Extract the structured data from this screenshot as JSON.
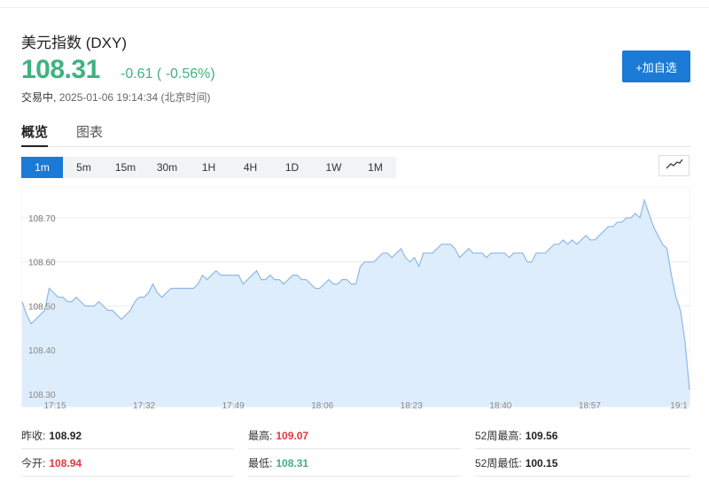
{
  "header": {
    "title": "美元指数 (DXY)",
    "price": "108.31",
    "change": "-0.61 ( -0.56%)",
    "status_label": "交易中,",
    "timestamp": "2025-01-06 19:14:34 (北京时间)",
    "add_button": "+加自选",
    "color_down": "#3fb27f",
    "color_up": "#e0393e",
    "accent": "#1a7ad6"
  },
  "tabs": [
    {
      "label": "概览",
      "active": true
    },
    {
      "label": "图表",
      "active": false
    }
  ],
  "intervals": [
    {
      "label": "1m",
      "active": true
    },
    {
      "label": "5m",
      "active": false
    },
    {
      "label": "15m",
      "active": false
    },
    {
      "label": "30m",
      "active": false
    },
    {
      "label": "1H",
      "active": false
    },
    {
      "label": "4H",
      "active": false
    },
    {
      "label": "1D",
      "active": false
    },
    {
      "label": "1W",
      "active": false
    },
    {
      "label": "1M",
      "active": false
    }
  ],
  "chart_toggle_icon": "line-chart-icon",
  "chart_data": {
    "type": "area",
    "title": "",
    "xlabel": "",
    "ylabel": "",
    "x_ticks": [
      "17:15",
      "17:32",
      "17:49",
      "18:06",
      "18:23",
      "18:40",
      "18:57",
      "19:1"
    ],
    "y_ticks": [
      "108.70",
      "108.60",
      "108.50",
      "108.40",
      "108.30"
    ],
    "ylim": [
      108.28,
      108.77
    ],
    "grid": "horizontal",
    "line_color": "#8fb8e6",
    "fill_color": "#deedfb",
    "series": [
      {
        "values": [
          108.51,
          108.48,
          108.46,
          108.47,
          108.48,
          108.49,
          108.54,
          108.53,
          108.52,
          108.52,
          108.51,
          108.51,
          108.52,
          108.51,
          108.5,
          108.5,
          108.5,
          108.51,
          108.5,
          108.49,
          108.49,
          108.48,
          108.47,
          108.48,
          108.49,
          108.51,
          108.52,
          108.52,
          108.53,
          108.55,
          108.53,
          108.52,
          108.53,
          108.54,
          108.54,
          108.54,
          108.54,
          108.54,
          108.54,
          108.55,
          108.57,
          108.56,
          108.57,
          108.58,
          108.57,
          108.57,
          108.57,
          108.57,
          108.57,
          108.55,
          108.56,
          108.57,
          108.58,
          108.56,
          108.56,
          108.57,
          108.56,
          108.56,
          108.55,
          108.56,
          108.57,
          108.57,
          108.56,
          108.56,
          108.55,
          108.54,
          108.54,
          108.55,
          108.56,
          108.55,
          108.55,
          108.56,
          108.56,
          108.55,
          108.55,
          108.59,
          108.6,
          108.6,
          108.6,
          108.61,
          108.62,
          108.62,
          108.61,
          108.62,
          108.63,
          108.61,
          108.6,
          108.61,
          108.59,
          108.62,
          108.62,
          108.62,
          108.63,
          108.64,
          108.64,
          108.64,
          108.63,
          108.61,
          108.62,
          108.63,
          108.62,
          108.62,
          108.62,
          108.61,
          108.62,
          108.62,
          108.62,
          108.62,
          108.61,
          108.62,
          108.62,
          108.62,
          108.6,
          108.6,
          108.62,
          108.62,
          108.62,
          108.63,
          108.64,
          108.64,
          108.65,
          108.64,
          108.65,
          108.64,
          108.65,
          108.66,
          108.65,
          108.65,
          108.66,
          108.67,
          108.68,
          108.68,
          108.69,
          108.69,
          108.7,
          108.7,
          108.71,
          108.7,
          108.74,
          108.71,
          108.68,
          108.66,
          108.64,
          108.63,
          108.57,
          108.52,
          108.49,
          108.42,
          108.31
        ]
      }
    ]
  },
  "stats": {
    "prev_close_label": "昨收:",
    "prev_close": "108.92",
    "open_label": "今开:",
    "open": "108.94",
    "high_label": "最高:",
    "high": "109.07",
    "low_label": "最低:",
    "low": "108.31",
    "wk52_high_label": "52周最高:",
    "wk52_high": "109.56",
    "wk52_low_label": "52周最低:",
    "wk52_low": "100.15"
  }
}
